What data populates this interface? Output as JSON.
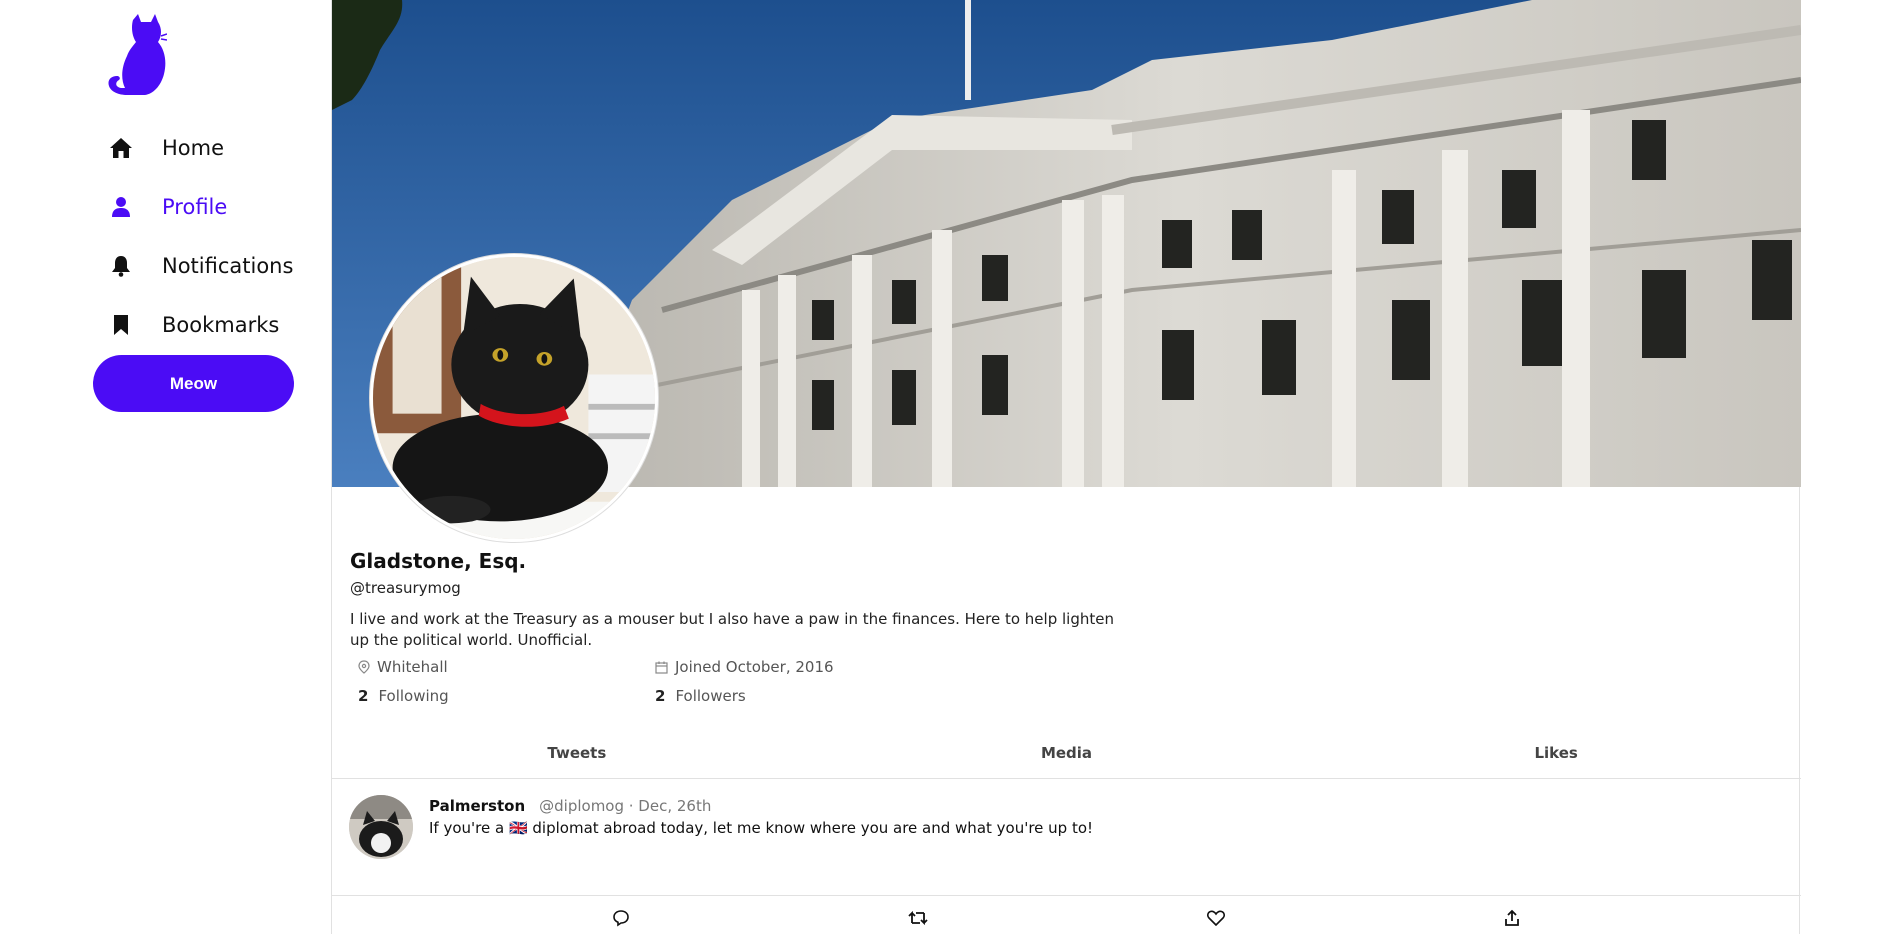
{
  "nav": {
    "items": [
      {
        "label": "Home",
        "icon": "home-icon"
      },
      {
        "label": "Profile",
        "icon": "person-icon",
        "active": true
      },
      {
        "label": "Notifications",
        "icon": "bell-icon"
      },
      {
        "label": "Bookmarks",
        "icon": "bookmark-icon"
      }
    ],
    "cta_label": "Meow"
  },
  "colors": {
    "accent": "#4b0cf5",
    "border": "#e1e1e1"
  },
  "profile": {
    "name": "Gladstone, Esq.",
    "handle": "@treasurymog",
    "bio": "I live and work at the Treasury as a mouser but I also have a paw in the finances. Here to help lighten up the political world. Unofficial.",
    "location": "Whitehall",
    "joined": "Joined October, 2016",
    "following_count": "2",
    "following_label": "Following",
    "followers_count": "2",
    "followers_label": "Followers"
  },
  "tabs": [
    "Tweets",
    "Media",
    "Likes"
  ],
  "tweet": {
    "author": "Palmerston",
    "meta": "@diplomog · Dec, 26th",
    "text": "If you're a 🇬🇧 diplomat abroad today, let me know where you are and what you're up to!"
  }
}
